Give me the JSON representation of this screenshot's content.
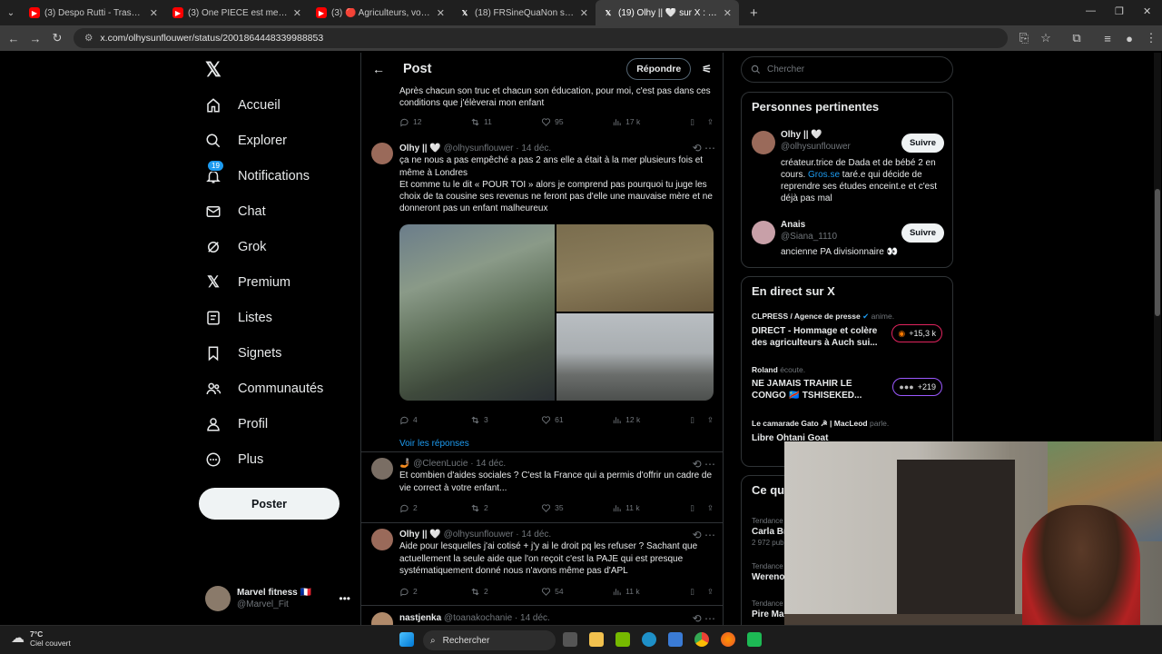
{
  "browser": {
    "tabs": [
      {
        "label": "(3) Despo Rutti - Trashhh - YouT",
        "color": "#ff0000"
      },
      {
        "label": "(3) One PIECE est meilleur sans",
        "color": "#ff0000"
      },
      {
        "label": "(3) 🔴 Agriculteurs, vote du bu",
        "color": "#ff0000"
      },
      {
        "label": "(18) FRSineQuaNon sur X : \"@T",
        "color": "#ffffff"
      },
      {
        "label": "(19) Olhy || 🤍 sur X : \"Quand n",
        "color": "#ffffff"
      }
    ],
    "url": "x.com/olhysunflouwer/status/2001864448339988853"
  },
  "leftnav": {
    "items": [
      {
        "label": "Accueil",
        "icon": "home-icon"
      },
      {
        "label": "Explorer",
        "icon": "search-icon"
      },
      {
        "label": "Notifications",
        "icon": "bell-icon",
        "badge": "19"
      },
      {
        "label": "Chat",
        "icon": "mail-icon"
      },
      {
        "label": "Grok",
        "icon": "grok-icon"
      },
      {
        "label": "Premium",
        "icon": "x-logo-icon"
      },
      {
        "label": "Listes",
        "icon": "list-icon"
      },
      {
        "label": "Signets",
        "icon": "bookmark-icon"
      },
      {
        "label": "Communautés",
        "icon": "people-icon"
      },
      {
        "label": "Profil",
        "icon": "person-icon"
      },
      {
        "label": "Plus",
        "icon": "more-icon"
      }
    ],
    "post_button": "Poster",
    "account": {
      "name": "Marvel fitness 🇫🇷",
      "handle": "@Marvel_Fit"
    }
  },
  "center": {
    "title": "Post",
    "reply_label": "Répondre",
    "top_tweet": {
      "text": "Après chacun son truc et chacun son éducation, pour moi, c'est pas dans ces conditions que j'élèverai mon enfant",
      "replies": "12",
      "reposts": "11",
      "likes": "95",
      "views": "17 k"
    },
    "tweets": [
      {
        "name": "Olhy || 🤍",
        "handle": "@olhysunflouwer",
        "date": "· 14 déc.",
        "text1": "ça ne nous a pas empêché a pas 2 ans elle a était à la mer plusieurs fois et même à Londres",
        "text2": "Et comme tu le dit « POUR TOI » alors je comprend pas pourquoi tu juge les choix de ta cousine ses revenus ne feront pas d'elle une mauvaise mère et ne donneront pas un enfant malheureux",
        "replies": "4",
        "reposts": "3",
        "likes": "61",
        "views": "12 k",
        "show_replies": "Voir les réponses"
      },
      {
        "name": "🤳🏾",
        "handle": "@CleenLucie",
        "date": "· 14 déc.",
        "text1": "Et combien d'aides sociales ? C'est la France qui a permis d'offrir un cadre de vie correct à votre enfant...",
        "replies": "2",
        "reposts": "2",
        "likes": "35",
        "views": "11 k"
      },
      {
        "name": "Olhy || 🤍",
        "handle": "@olhysunflouwer",
        "date": "· 14 déc.",
        "text1": "Aide pour lesquelles j'ai cotisé + j'y ai le droit pq les refuser ? Sachant que actuellement la seule aide que l'on reçoit c'est la PAJE qui est presque systématiquement donné nous n'avons même pas d'APL",
        "replies": "2",
        "reposts": "2",
        "likes": "54",
        "views": "11 k"
      },
      {
        "name": "nastjenka",
        "handle": "@toanakochanie",
        "date": "· 14 déc."
      }
    ]
  },
  "right": {
    "search_placeholder": "Chercher",
    "relevant": {
      "title": "Personnes pertinentes",
      "people": [
        {
          "name": "Olhy || 🤍",
          "handle": "@olhysunflouwer",
          "bio_a": "créateur.trice de Dada et de bébé 2 en cours. ",
          "bio_link": "Gros.se",
          "bio_b": " taré.e qui décide de reprendre ses études enceint.e et c'est déjà pas mal",
          "follow": "Suivre"
        },
        {
          "name": "Anais",
          "handle": "@Siana_1110",
          "bio_a": "ancienne PA divisionnaire 👀",
          "bio_link": "",
          "bio_b": "",
          "follow": "Suivre"
        }
      ]
    },
    "live": {
      "title": "En direct sur X",
      "items": [
        {
          "host": "CLPRESS / Agence de presse",
          "status": "anime.",
          "title": "DIRECT - Hommage et colère des agriculteurs à Auch sui...",
          "count": "+15,3 k"
        },
        {
          "host": "Roland",
          "status": "écoute.",
          "title": "NE JAMAIS TRAHIR LE CONGO 🇨🇩 TSHISEKED...",
          "count": "+219"
        },
        {
          "host": "Le camarade Gato ☭ | MacLeod",
          "status": "parle.",
          "title": "Libre Ohtani Goat",
          "count": ""
        }
      ]
    },
    "trends": {
      "title": "Ce qu",
      "items": [
        {
          "label": "Tendance",
          "name": "Carla Br",
          "posts": "2 972 pub"
        },
        {
          "label": "Tendance",
          "name": "Wereno",
          "posts": ""
        },
        {
          "label": "Tendance",
          "name": "Pire Ma",
          "posts": ""
        }
      ]
    }
  },
  "taskbar": {
    "temp": "7°C",
    "weather": "Ciel couvert",
    "search": "Rechercher"
  }
}
